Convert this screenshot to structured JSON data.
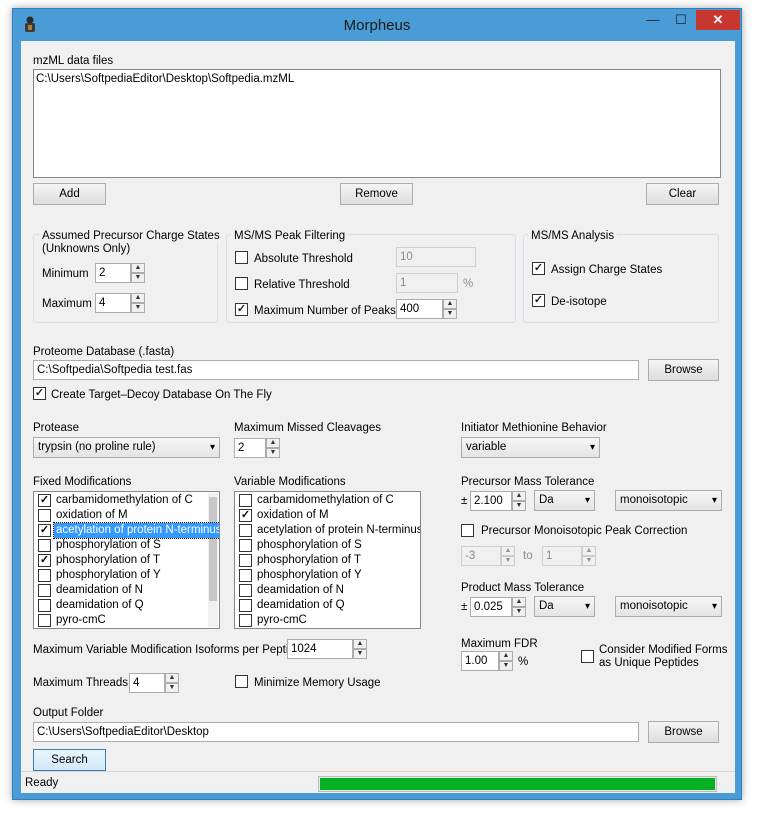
{
  "window": {
    "title": "Morpheus",
    "minimize": "—",
    "maximize": "☐",
    "close": "✕"
  },
  "mzml": {
    "label": "mzML data files",
    "files": [
      "C:\\Users\\SoftpediaEditor\\Desktop\\Softpedia.mzML"
    ],
    "add": "Add",
    "remove": "Remove",
    "clear": "Clear"
  },
  "charge": {
    "title_line1": "Assumed Precursor Charge States",
    "title_line2": "(Unknowns Only)",
    "min_label": "Minimum",
    "min_value": "2",
    "max_label": "Maximum",
    "max_value": "4"
  },
  "peak_filter": {
    "title": "MS/MS Peak Filtering",
    "absolute_label": "Absolute Threshold",
    "absolute_checked": false,
    "absolute_value": "10",
    "relative_label": "Relative Threshold",
    "relative_checked": false,
    "relative_value": "1",
    "relative_unit": "%",
    "maxpeaks_label": "Maximum Number of Peaks",
    "maxpeaks_checked": true,
    "maxpeaks_value": "400"
  },
  "analysis": {
    "title": "MS/MS Analysis",
    "assign_label": "Assign Charge States",
    "assign_checked": true,
    "deisotope_label": "De-isotope",
    "deisotope_checked": true
  },
  "proteome": {
    "label": "Proteome Database (.fasta)",
    "value": "C:\\Softpedia\\Softpedia test.fas",
    "browse": "Browse",
    "decoy_label": "Create Target–Decoy Database On The Fly",
    "decoy_checked": true
  },
  "protease": {
    "label": "Protease",
    "value": "trypsin (no proline rule)"
  },
  "missed": {
    "label": "Maximum Missed Cleavages",
    "value": "2"
  },
  "initiator": {
    "label": "Initiator Methionine Behavior",
    "value": "variable"
  },
  "fixed_mods": {
    "label": "Fixed Modifications",
    "items": [
      {
        "text": "carbamidomethylation of C",
        "checked": true
      },
      {
        "text": "oxidation of M",
        "checked": false
      },
      {
        "text": "acetylation of protein N-terminus",
        "checked": true
      },
      {
        "text": "phosphorylation of S",
        "checked": false
      },
      {
        "text": "phosphorylation of T",
        "checked": true
      },
      {
        "text": "phosphorylation of Y",
        "checked": false
      },
      {
        "text": "deamidation of N",
        "checked": false
      },
      {
        "text": "deamidation of Q",
        "checked": false
      },
      {
        "text": "pyro-cmC",
        "checked": false
      }
    ]
  },
  "variable_mods": {
    "label": "Variable Modifications",
    "items": [
      {
        "text": "carbamidomethylation of C",
        "checked": false
      },
      {
        "text": "oxidation of M",
        "checked": true
      },
      {
        "text": "acetylation of protein N-terminus",
        "checked": false
      },
      {
        "text": "phosphorylation of S",
        "checked": false
      },
      {
        "text": "phosphorylation of T",
        "checked": false
      },
      {
        "text": "phosphorylation of Y",
        "checked": false
      },
      {
        "text": "deamidation of N",
        "checked": false
      },
      {
        "text": "deamidation of Q",
        "checked": false
      },
      {
        "text": "pyro-cmC",
        "checked": false
      }
    ]
  },
  "precursor": {
    "label": "Precursor Mass Tolerance",
    "pm": "±",
    "value": "2.100",
    "unit": "Da",
    "type": "monoisotopic",
    "correction_label": "Precursor Monoisotopic Peak Correction",
    "correction_checked": false,
    "corr_from": "-3",
    "corr_to_label": "to",
    "corr_to": "1"
  },
  "product": {
    "label": "Product Mass Tolerance",
    "pm": "±",
    "value": "0.025",
    "unit": "Da",
    "type": "monoisotopic"
  },
  "fdr": {
    "label": "Maximum FDR",
    "value": "1.00",
    "unit": "%",
    "unique_label_line1": "Consider Modified Forms",
    "unique_label_line2": "as Unique Peptides",
    "unique_checked": false
  },
  "isoforms": {
    "label": "Maximum Variable Modification Isoforms per Peptide",
    "value": "1024"
  },
  "threads": {
    "label": "Maximum Threads",
    "value": "4",
    "minmem_label": "Minimize Memory Usage",
    "minmem_checked": false
  },
  "output": {
    "label": "Output Folder",
    "value": "C:\\Users\\SoftpediaEditor\\Desktop",
    "browse": "Browse"
  },
  "search": {
    "label": "Search"
  },
  "status": {
    "text": "Ready",
    "progress": 1.0,
    "progress_color": "#06b025"
  }
}
